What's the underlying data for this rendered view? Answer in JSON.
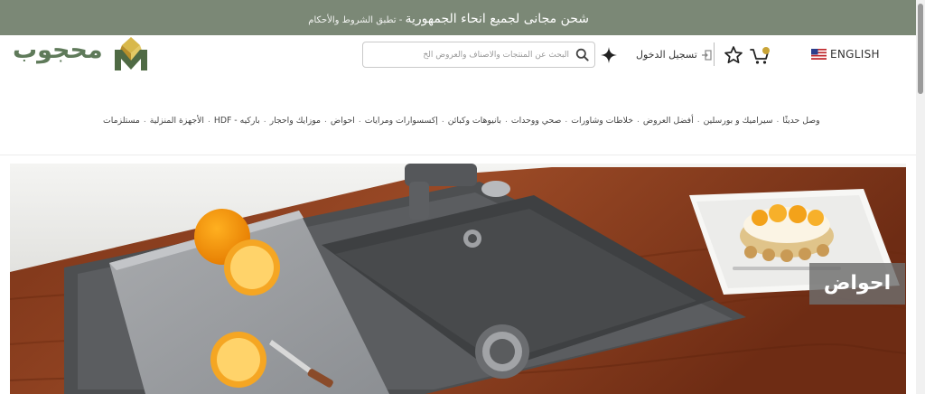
{
  "banner": {
    "main": "شحن مجانى لجميع انحاء الجمهورية",
    "separator": " - ",
    "terms": "تطبق الشروط والأحكام"
  },
  "header": {
    "language": "ENGLISH",
    "login": "تسجيل الدخول",
    "search_placeholder": "البحث عن المنتجات والاصناف والعروض الخ",
    "logo_text": "محجوب",
    "icons": [
      "us-flag-icon",
      "cart-icon",
      "star-icon",
      "login-icon",
      "sparkle-icon",
      "search-icon"
    ]
  },
  "nav": {
    "items": [
      "وصل حديثًا",
      "سيراميك و بورسلين",
      "أفضل العروض",
      "خلاطات وشاورات",
      "صحي ووحدات",
      "بانيوهات وكبائن",
      "إكسسوارات ومرايات",
      "احواض",
      "موزايك واحجار",
      "باركيه - HDF",
      "الأجهزة المنزلية",
      "مستلزمات"
    ]
  },
  "hero": {
    "label": "احواض"
  },
  "colors": {
    "banner_bg": "#7b8876",
    "brand_green": "#5f7a5a",
    "logo_gold": "#c9a436",
    "hero_label_bg": "#6e6e6e"
  }
}
